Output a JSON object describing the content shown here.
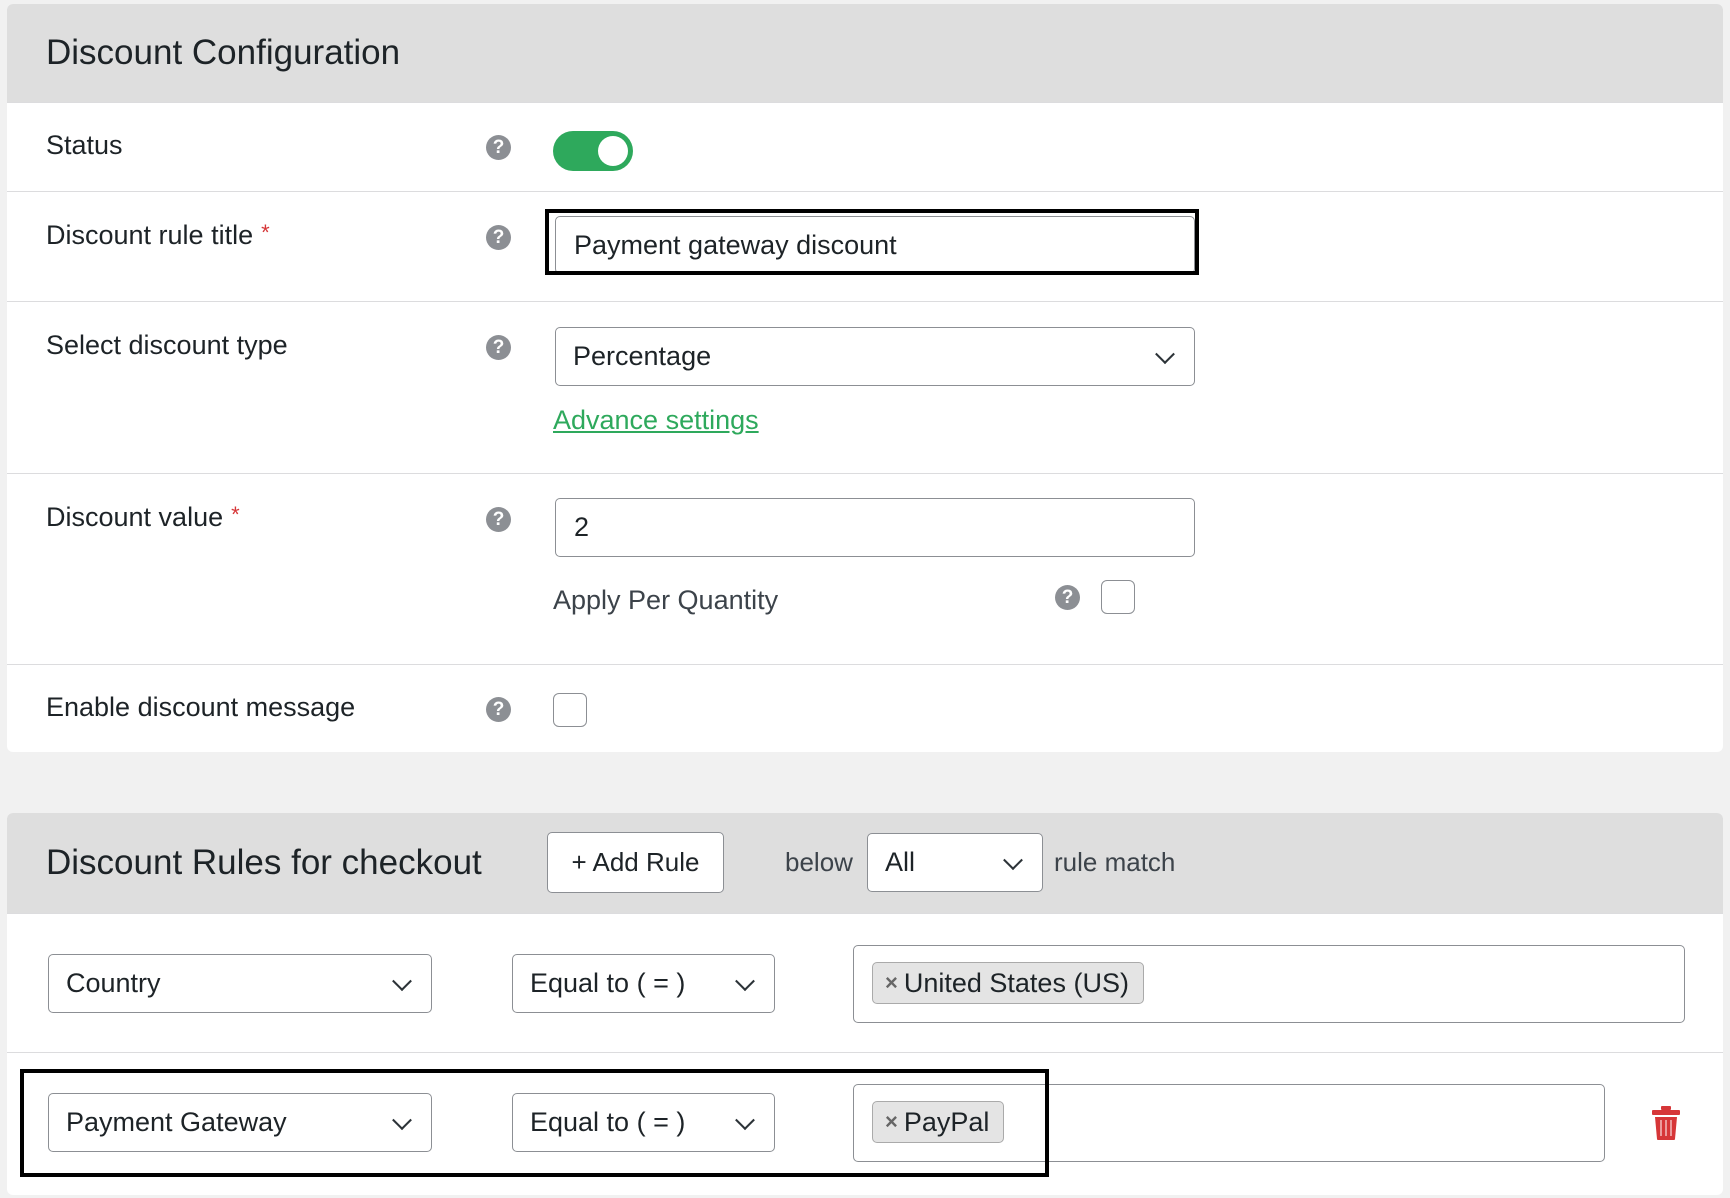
{
  "config": {
    "title": "Discount Configuration",
    "status": {
      "label": "Status",
      "enabled": true
    },
    "rule_title": {
      "label": "Discount rule title",
      "required_mark": "*",
      "value": "Payment gateway discount"
    },
    "discount_type": {
      "label": "Select discount type",
      "value": "Percentage",
      "advance_link": "Advance settings"
    },
    "discount_value": {
      "label": "Discount value",
      "required_mark": "*",
      "value": "2",
      "apply_per_quantity_label": "Apply Per Quantity",
      "apply_per_quantity_checked": false
    },
    "discount_message": {
      "label": "Enable discount message",
      "checked": false
    },
    "help_glyph": "?"
  },
  "rules": {
    "title": "Discount Rules for checkout",
    "add_rule_label": "+ Add Rule",
    "below_text": "below",
    "match_value": "All",
    "match_suffix": "rule match",
    "rows": [
      {
        "field": "Country",
        "operator": "Equal to ( = )",
        "tag": "United States (US)"
      },
      {
        "field": "Payment Gateway",
        "operator": "Equal to ( = )",
        "tag": "PayPal"
      }
    ],
    "tag_remove_glyph": "×"
  },
  "colors": {
    "accent_green": "#2ea95c",
    "required_red": "#d63638",
    "trash_red": "#d63638"
  }
}
